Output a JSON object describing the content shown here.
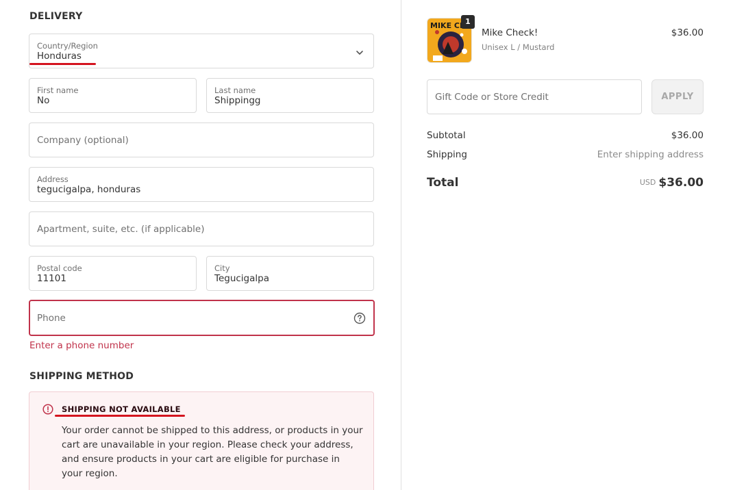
{
  "delivery": {
    "title": "DELIVERY",
    "country": {
      "label": "Country/Region",
      "value": "Honduras"
    },
    "first_name": {
      "label": "First name",
      "value": "No"
    },
    "last_name": {
      "label": "Last name",
      "value": "Shippingg"
    },
    "company": {
      "placeholder": "Company (optional)"
    },
    "address": {
      "label": "Address",
      "value": "tegucigalpa, honduras"
    },
    "apartment": {
      "placeholder": "Apartment, suite, etc. (if applicable)"
    },
    "postal_code": {
      "label": "Postal code",
      "value": "11101"
    },
    "city": {
      "label": "City",
      "value": "Tegucigalpa"
    },
    "phone": {
      "placeholder": "Phone",
      "error": "Enter a phone number"
    }
  },
  "shipping_method": {
    "title": "SHIPPING METHOD",
    "alert_title": "SHIPPING NOT AVAILABLE",
    "alert_body": "Your order cannot be shipped to this address, or products in your cart are unavailable in your region. Please check your address, and ensure products in your cart are eligible for purchase in your region."
  },
  "summary": {
    "product": {
      "name": "Mike Check!",
      "variant": "Unisex L / Mustard",
      "price": "$36.00",
      "quantity": "1",
      "image_text": "MIKE CHE"
    },
    "gift_code": {
      "placeholder": "Gift Code or Store Credit",
      "apply_label": "APPLY"
    },
    "subtotal": {
      "label": "Subtotal",
      "value": "$36.00"
    },
    "shipping": {
      "label": "Shipping",
      "value": "Enter shipping address"
    },
    "total": {
      "label": "Total",
      "currency": "USD",
      "value": "$36.00"
    }
  },
  "colors": {
    "error": "#c0324a",
    "annotation_underline": "#d4141f",
    "alert_background": "#fdf3f4",
    "product_image_background": "#f2a81d"
  }
}
